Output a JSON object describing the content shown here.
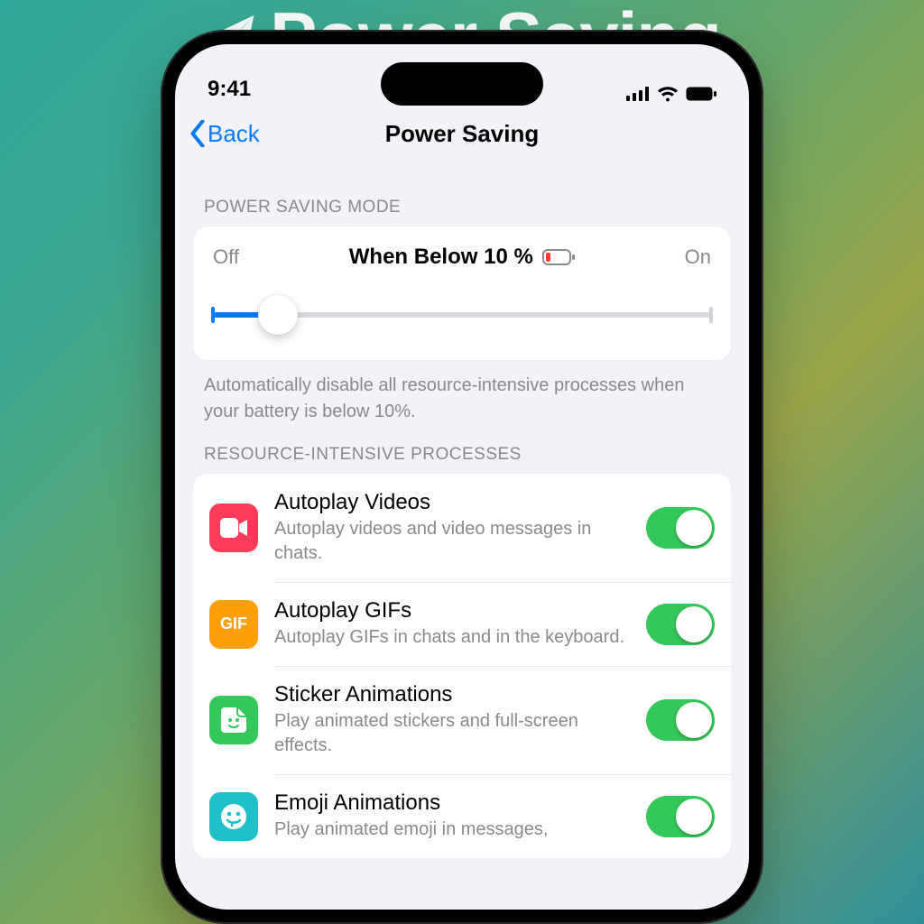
{
  "background_title": "Power Saving",
  "status": {
    "time": "9:41"
  },
  "nav": {
    "back": "Back",
    "title": "Power Saving"
  },
  "slider": {
    "header": "POWER SAVING MODE",
    "off": "Off",
    "center": "When Below 10 %",
    "on": "On",
    "percent": 10,
    "footer": "Automatically disable all resource-intensive processes when your battery is below 10%."
  },
  "processes_header": "RESOURCE-INTENSIVE PROCESSES",
  "rows": [
    {
      "icon": "video-icon",
      "title": "Autoplay Videos",
      "sub": "Autoplay videos and video messages in chats.",
      "on": true
    },
    {
      "icon": "gif-icon",
      "title": "Autoplay GIFs",
      "sub": "Autoplay GIFs in chats and in the keyboard.",
      "on": true,
      "gif_label": "GIF"
    },
    {
      "icon": "sticker-icon",
      "title": "Sticker Animations",
      "sub": "Play animated stickers and full-screen effects.",
      "on": true
    },
    {
      "icon": "emoji-icon",
      "title": "Emoji Animations",
      "sub": "Play animated emoji in messages,",
      "on": true
    }
  ]
}
